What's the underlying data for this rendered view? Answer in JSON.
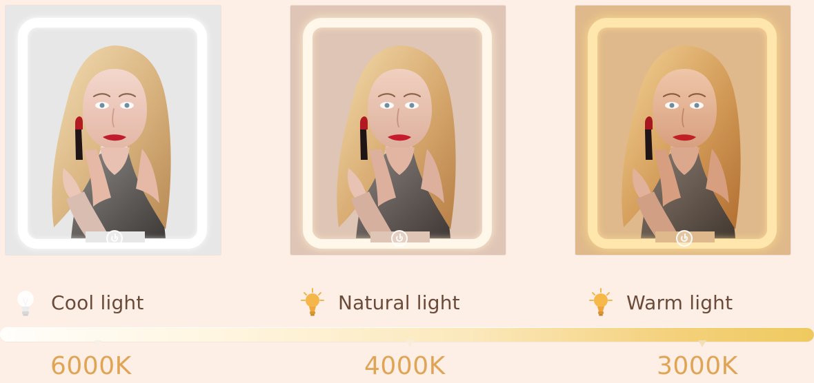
{
  "light_modes": [
    {
      "label": "Cool light",
      "temperature": "6000K",
      "icon": "cool-bulb-icon"
    },
    {
      "label": "Natural light",
      "temperature": "4000K",
      "icon": "natural-bulb-icon"
    },
    {
      "label": "Warm light",
      "temperature": "3000K",
      "icon": "warm-bulb-icon"
    }
  ],
  "colors": {
    "background": "#fdeee6",
    "label_text": "#6a4a38",
    "temperature_text": "#e0a455",
    "cool_panel": "#e7e7e8",
    "natural_panel": "#dfc5b5",
    "warm_panel": "#dfb98b",
    "spectrum_start": "#fffefb",
    "spectrum_end": "#efc95f"
  }
}
